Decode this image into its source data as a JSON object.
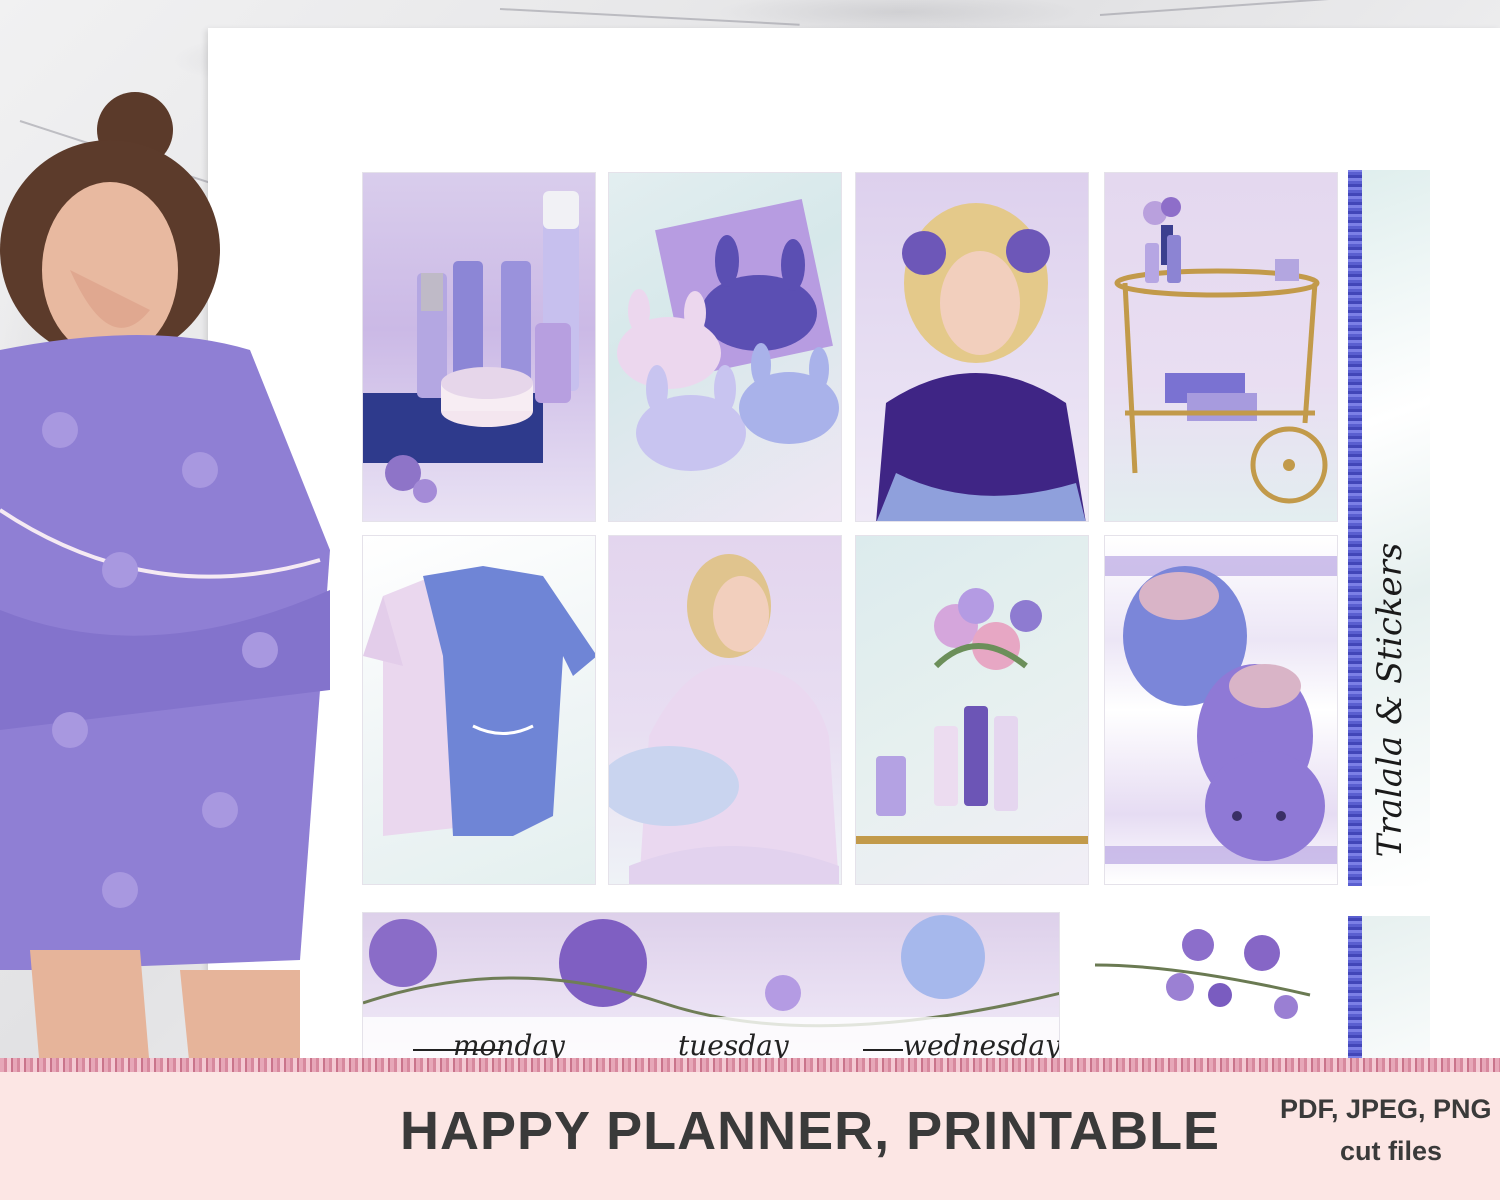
{
  "colors": {
    "lavender": "#b9a8e2",
    "violet": "#6b5bb5",
    "periwinkle": "#7f8ad8",
    "blush_footer": "#fce6e4",
    "footer_text": "#3a3a3a"
  },
  "stickers": [
    {
      "name": "skincare-products-sticker",
      "icon": "skincare-bottles-icon"
    },
    {
      "name": "bunny-sleep-masks-sticker",
      "icon": "sleep-mask-icon"
    },
    {
      "name": "hair-rollers-woman-sticker",
      "icon": "woman-portrait-icon"
    },
    {
      "name": "bar-cart-sticker",
      "icon": "bar-cart-icon"
    },
    {
      "name": "pajama-sets-sticker",
      "icon": "pajamas-icon"
    },
    {
      "name": "pajama-woman-sticker",
      "icon": "woman-portrait-icon"
    },
    {
      "name": "flowers-bottles-sticker",
      "icon": "flower-vase-icon"
    },
    {
      "name": "bunny-slippers-sticker",
      "icon": "slippers-icon"
    }
  ],
  "side_strip": {
    "text": "Tralala & Stickers"
  },
  "banner": {
    "days": [
      "monday",
      "tuesday",
      "wednesday"
    ]
  },
  "footer": {
    "title": "HAPPY PLANNER, PRINTABLE",
    "formats": "PDF, JPEG, PNG",
    "cut": "cut files"
  }
}
